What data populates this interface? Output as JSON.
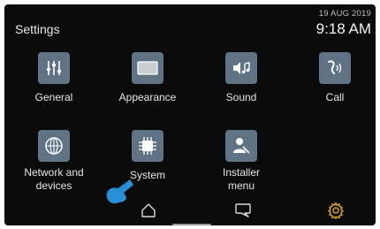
{
  "header": {
    "title": "Settings",
    "date": "19 AUG 2019",
    "time": "9:18 AM"
  },
  "tiles": [
    {
      "label": "General",
      "icon": "sliders-icon"
    },
    {
      "label": "Appearance",
      "icon": "display-icon"
    },
    {
      "label": "Sound",
      "icon": "speaker-music-icon"
    },
    {
      "label": "Call",
      "icon": "phone-sound-icon"
    },
    {
      "label": "Network and",
      "label2": "devices",
      "icon": "network-globe-icon"
    },
    {
      "label": "System",
      "icon": "chip-icon"
    },
    {
      "label": "Installer",
      "label2": "menu",
      "icon": "installer-tools-icon"
    }
  ],
  "nav": [
    {
      "name": "home",
      "icon": "home-icon"
    },
    {
      "name": "messages",
      "icon": "chat-bubble-icon"
    },
    {
      "name": "settings",
      "icon": "gear-icon"
    }
  ],
  "colors": {
    "background": "#0b0b0c",
    "tile": "#5f7384",
    "accent": "#d9a02a",
    "pointer": "#2a90d6"
  }
}
